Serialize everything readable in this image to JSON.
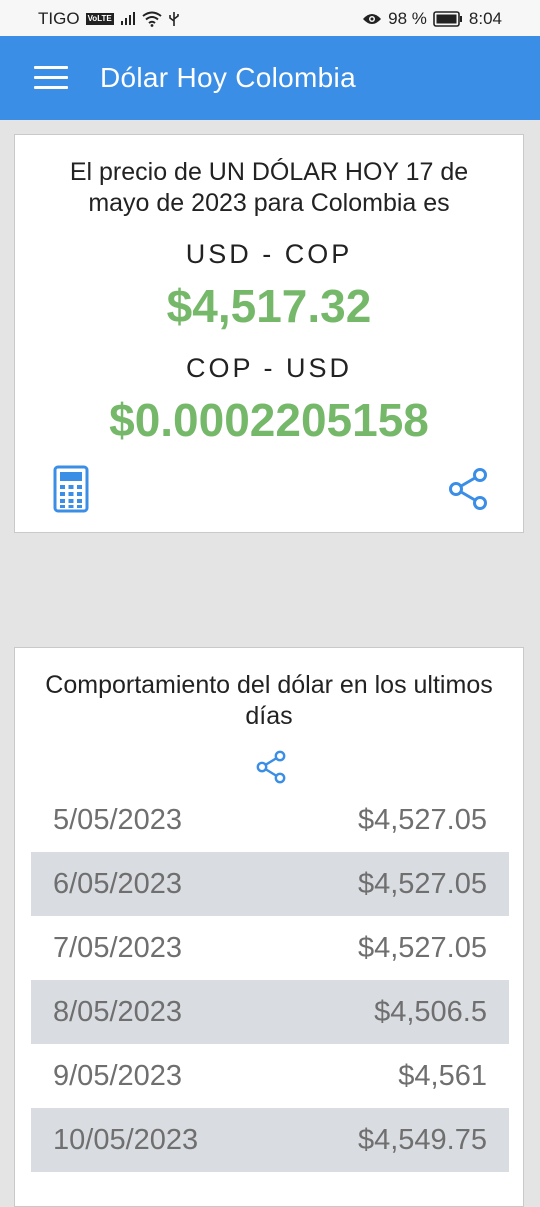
{
  "status_bar": {
    "carrier": "TIGO",
    "volte": "VoLTE",
    "battery": "98 %",
    "time": "8:04"
  },
  "app_bar": {
    "title": "Dólar Hoy Colombia"
  },
  "rate_card": {
    "headline": "El precio de UN DÓLAR HOY 17 de mayo de 2023 para Colombia es",
    "usd_cop_label": "USD - COP",
    "usd_cop_value": "$4,517.32",
    "cop_usd_label": "COP - USD",
    "cop_usd_value": "$0.0002205158",
    "accent_color": "#76b86a",
    "icons": [
      "calculator-icon",
      "share-icon"
    ]
  },
  "history_card": {
    "headline": "Comportamiento del dólar en los ultimos días",
    "rows": [
      {
        "date": "5/05/2023",
        "value": "$4,527.05"
      },
      {
        "date": "6/05/2023",
        "value": "$4,527.05"
      },
      {
        "date": "7/05/2023",
        "value": "$4,527.05"
      },
      {
        "date": "8/05/2023",
        "value": "$4,506.5"
      },
      {
        "date": "9/05/2023",
        "value": "$4,561"
      },
      {
        "date": "10/05/2023",
        "value": "$4,549.75"
      }
    ]
  },
  "colors": {
    "app_bar": "#3b8ee6",
    "icon_blue": "#3b8ee6",
    "background": "#e4e4e4",
    "alt_row": "#d9dce0"
  }
}
